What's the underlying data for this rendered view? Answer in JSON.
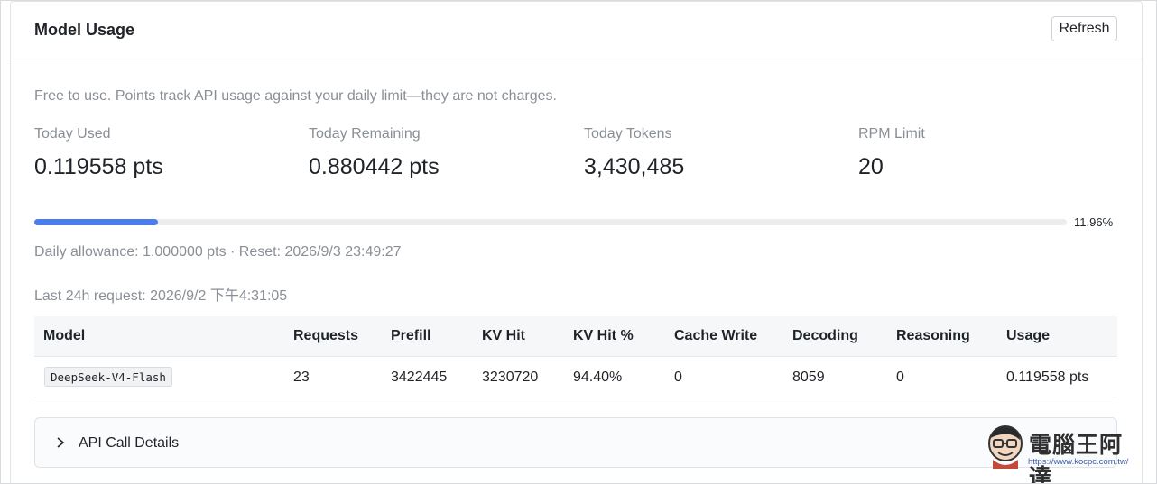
{
  "header": {
    "title": "Model Usage",
    "refresh_label": "Refresh"
  },
  "note": "Free to use. Points track API usage against your daily limit—they are not charges.",
  "stats": [
    {
      "label": "Today Used",
      "value": "0.119558 pts"
    },
    {
      "label": "Today Remaining",
      "value": "0.880442 pts"
    },
    {
      "label": "Today Tokens",
      "value": "3,430,485"
    },
    {
      "label": "RPM Limit",
      "value": "20"
    }
  ],
  "progress": {
    "fraction": 0.1196,
    "label": "11.96%",
    "color": "#4c7bf0"
  },
  "allowance": "Daily allowance: 1.000000 pts · Reset: 2026/9/3 23:49:27",
  "last_request": "Last 24h request: 2026/9/2 下午4:31:05",
  "table": {
    "columns": [
      "Model",
      "Requests",
      "Prefill",
      "KV Hit",
      "KV Hit %",
      "Cache Write",
      "Decoding",
      "Reasoning",
      "Usage"
    ],
    "rows": [
      {
        "model": "DeepSeek-V4-Flash",
        "requests": "23",
        "prefill": "3422445",
        "kv_hit": "3230720",
        "kv_hit_pct": "94.40%",
        "cache_write": "0",
        "decoding": "8059",
        "reasoning": "0",
        "usage": "0.119558 pts"
      }
    ]
  },
  "details": {
    "label": "API Call Details",
    "icon": "chevron-right-icon"
  },
  "watermark": {
    "text": "電腦王阿達",
    "url": "https://www.kocpc.com.tw/"
  }
}
